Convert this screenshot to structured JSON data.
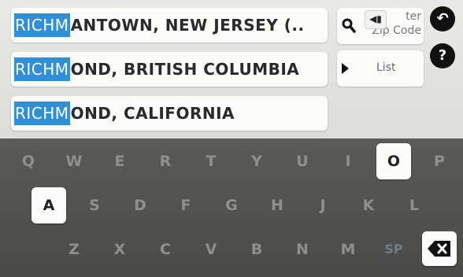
{
  "results": [
    {
      "highlight": "RICHM",
      "rest": "ANTOWN, NEW JERSEY (.."
    },
    {
      "highlight": "RICHM",
      "rest": "OND, BRITISH COLUMBIA"
    },
    {
      "highlight": "RICHM",
      "rest": "OND, CALIFORNIA"
    }
  ],
  "side": {
    "zip_label_line1": "ter",
    "zip_label_line2": "Zip Code",
    "zip_icon_glyph": "◀▮",
    "list_label": "List",
    "search_icon": "magnifier-icon",
    "play_icon": "play-icon"
  },
  "round": {
    "back_glyph": "↶",
    "help_glyph": "?"
  },
  "keyboard": {
    "row1": [
      "Q",
      "W",
      "E",
      "R",
      "T",
      "Y",
      "U",
      "I",
      "O",
      "P"
    ],
    "row2": [
      "A",
      "S",
      "D",
      "F",
      "G",
      "H",
      "J",
      "K",
      "L"
    ],
    "row3": [
      "Z",
      "X",
      "C",
      "V",
      "B",
      "N",
      "M",
      "SP"
    ],
    "active_keys": [
      "O",
      "A"
    ],
    "backspace_icon": "backspace-icon"
  }
}
